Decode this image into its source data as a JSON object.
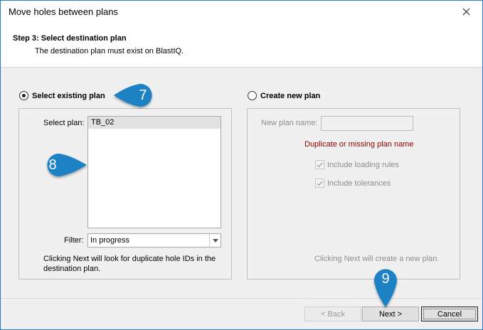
{
  "window": {
    "title": "Move holes between plans",
    "close_glyph": "✕",
    "accent_color": "#2b79d0"
  },
  "header": {
    "step": "Step 3: Select destination plan",
    "description": "The destination plan must exist on BlastIQ."
  },
  "existing": {
    "radio_label": "Select existing plan",
    "selected": true,
    "select_plan_label": "Select plan:",
    "plans": [
      "TB_02"
    ],
    "filter_label": "Filter:",
    "filter_value": "In progress",
    "note": "Clicking Next will look for duplicate hole IDs in the destination plan."
  },
  "create": {
    "radio_label": "Create new plan",
    "selected": false,
    "name_label": "New plan name:",
    "name_value": "",
    "error": "Duplicate or missing plan name",
    "include_loading_rules": "Include loading rules",
    "include_tolerances": "Include tolerances",
    "note": "Clicking Next will create a new plan."
  },
  "footer": {
    "back": "< Back",
    "next": "Next >",
    "cancel": "Cancel"
  },
  "callouts": {
    "seven": "7",
    "eight": "8",
    "nine": "9",
    "color": "#1a82c4"
  }
}
